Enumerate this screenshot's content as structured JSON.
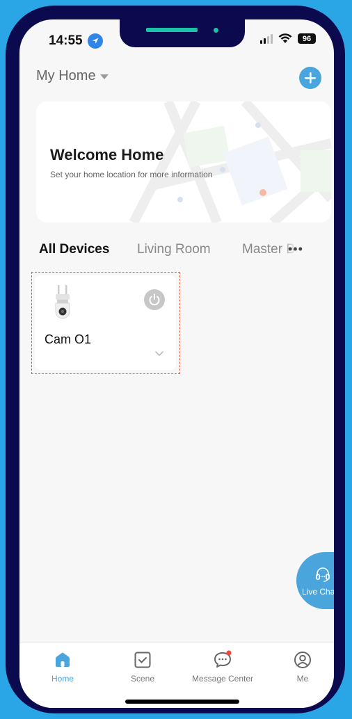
{
  "status_bar": {
    "time": "14:55",
    "battery": "96"
  },
  "header": {
    "home_name": "My Home"
  },
  "welcome_card": {
    "title": "Welcome Home",
    "subtitle": "Set your home location for more information"
  },
  "room_tabs": [
    {
      "label": "All Devices",
      "active": true
    },
    {
      "label": "Living Room",
      "active": false
    },
    {
      "label": "Master Bedroom",
      "active": false
    }
  ],
  "devices": [
    {
      "name": "Cam O1",
      "power": "off"
    }
  ],
  "live_chat": {
    "label": "Live Chat"
  },
  "bottom_nav": [
    {
      "label": "Home",
      "icon": "home-icon",
      "active": true
    },
    {
      "label": "Scene",
      "icon": "scene-icon",
      "active": false
    },
    {
      "label": "Message Center",
      "icon": "message-icon",
      "active": false,
      "badge": true
    },
    {
      "label": "Me",
      "icon": "user-icon",
      "active": false
    }
  ],
  "colors": {
    "accent": "#4aa5dc",
    "frame": "#0c0a4e",
    "background": "#2aa6e6",
    "highlight_border": "#e85a3a"
  }
}
